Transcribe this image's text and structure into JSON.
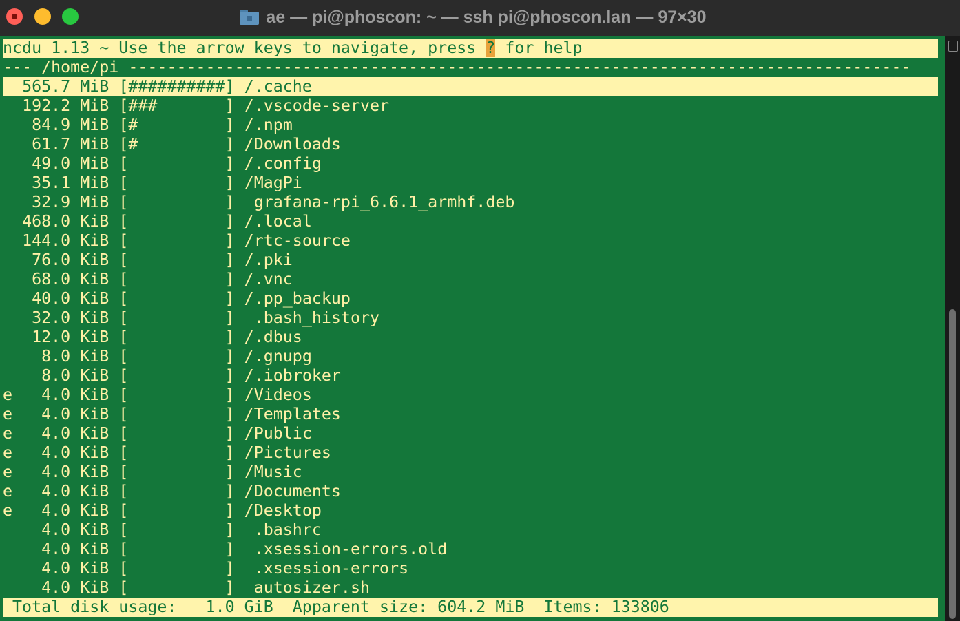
{
  "window": {
    "title": "ae — pi@phoscon: ~ — ssh pi@phoscon.lan — 97×30"
  },
  "ncdu": {
    "header_prefix": "ncdu 1.13 ~ Use the arrow keys to navigate, press ",
    "header_key": "?",
    "header_suffix": " for help",
    "path_line": "--- /home/pi ---------------------------------------------------------------------------------",
    "selected_index": 0,
    "rows": [
      {
        "flag": " ",
        "size": "565.7 MiB",
        "graph": "##########",
        "name": "/.cache"
      },
      {
        "flag": " ",
        "size": "192.2 MiB",
        "graph": "###       ",
        "name": "/.vscode-server"
      },
      {
        "flag": " ",
        "size": " 84.9 MiB",
        "graph": "#         ",
        "name": "/.npm"
      },
      {
        "flag": " ",
        "size": " 61.7 MiB",
        "graph": "#         ",
        "name": "/Downloads"
      },
      {
        "flag": " ",
        "size": " 49.0 MiB",
        "graph": "          ",
        "name": "/.config"
      },
      {
        "flag": " ",
        "size": " 35.1 MiB",
        "graph": "          ",
        "name": "/MagPi"
      },
      {
        "flag": " ",
        "size": " 32.9 MiB",
        "graph": "          ",
        "name": " grafana-rpi_6.6.1_armhf.deb"
      },
      {
        "flag": " ",
        "size": "468.0 KiB",
        "graph": "          ",
        "name": "/.local"
      },
      {
        "flag": " ",
        "size": "144.0 KiB",
        "graph": "          ",
        "name": "/rtc-source"
      },
      {
        "flag": " ",
        "size": " 76.0 KiB",
        "graph": "          ",
        "name": "/.pki"
      },
      {
        "flag": " ",
        "size": " 68.0 KiB",
        "graph": "          ",
        "name": "/.vnc"
      },
      {
        "flag": " ",
        "size": " 40.0 KiB",
        "graph": "          ",
        "name": "/.pp_backup"
      },
      {
        "flag": " ",
        "size": " 32.0 KiB",
        "graph": "          ",
        "name": " .bash_history"
      },
      {
        "flag": " ",
        "size": " 12.0 KiB",
        "graph": "          ",
        "name": "/.dbus"
      },
      {
        "flag": " ",
        "size": "  8.0 KiB",
        "graph": "          ",
        "name": "/.gnupg"
      },
      {
        "flag": " ",
        "size": "  8.0 KiB",
        "graph": "          ",
        "name": "/.iobroker"
      },
      {
        "flag": "e",
        "size": "  4.0 KiB",
        "graph": "          ",
        "name": "/Videos"
      },
      {
        "flag": "e",
        "size": "  4.0 KiB",
        "graph": "          ",
        "name": "/Templates"
      },
      {
        "flag": "e",
        "size": "  4.0 KiB",
        "graph": "          ",
        "name": "/Public"
      },
      {
        "flag": "e",
        "size": "  4.0 KiB",
        "graph": "          ",
        "name": "/Pictures"
      },
      {
        "flag": "e",
        "size": "  4.0 KiB",
        "graph": "          ",
        "name": "/Music"
      },
      {
        "flag": "e",
        "size": "  4.0 KiB",
        "graph": "          ",
        "name": "/Documents"
      },
      {
        "flag": "e",
        "size": "  4.0 KiB",
        "graph": "          ",
        "name": "/Desktop"
      },
      {
        "flag": " ",
        "size": "  4.0 KiB",
        "graph": "          ",
        "name": " .bashrc"
      },
      {
        "flag": " ",
        "size": "  4.0 KiB",
        "graph": "          ",
        "name": " .xsession-errors.old"
      },
      {
        "flag": " ",
        "size": "  4.0 KiB",
        "graph": "          ",
        "name": " .xsession-errors"
      },
      {
        "flag": " ",
        "size": "  4.0 KiB",
        "graph": "          ",
        "name": " autosizer.sh"
      }
    ],
    "footer": " Total disk usage:   1.0 GiB  Apparent size: 604.2 MiB  Items: 133806"
  },
  "colors": {
    "background": "#14773a",
    "foreground": "#fff0a6",
    "highlight": "#fff4ac",
    "help_key": "#e8a33c"
  },
  "icons": {
    "title_folder": "folder-icon",
    "scrollbar_top": "scroll-top-icon"
  }
}
